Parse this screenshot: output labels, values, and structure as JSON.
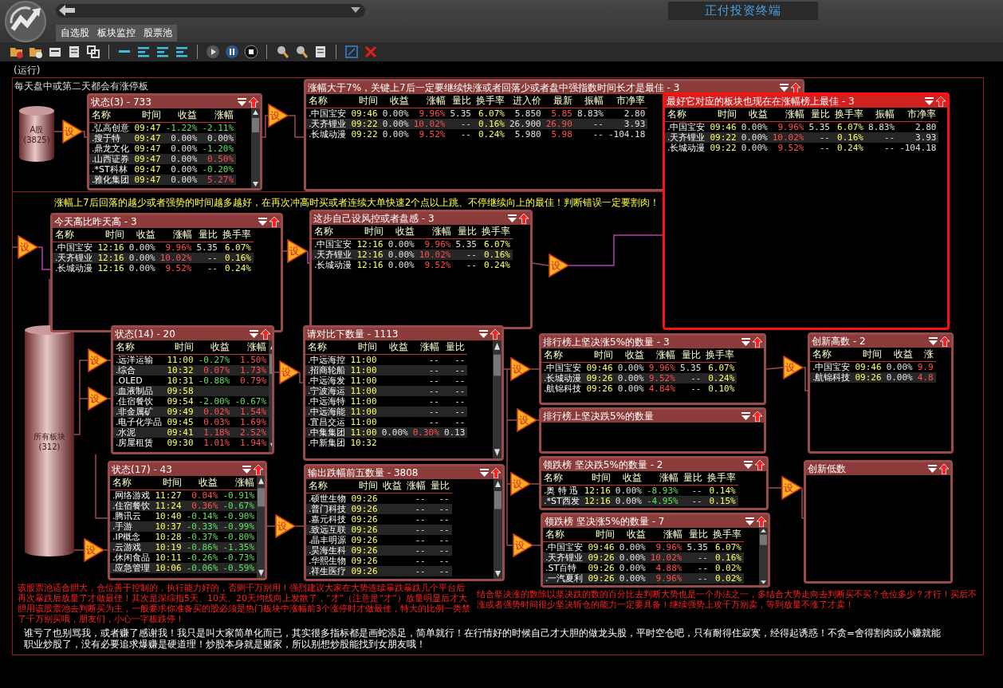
{
  "app": {
    "title": "正付投资终端"
  },
  "tabs": [
    {
      "label": "自选股",
      "selected": false
    },
    {
      "label": "板块监控",
      "selected": false
    },
    {
      "label": "股票池",
      "selected": false
    }
  ],
  "status": "(运行)",
  "section_title": "每天盘中或第二天都会有涨停板",
  "section_note": "涨幅上7后回落的越少或者强势的时间越多越好，在再次冲高时买或者连续大单快速2个点以上跳、不停继续向上的最佳！判断错误一定要割肉！",
  "sources": [
    {
      "label": "A股",
      "count": "(3825)"
    },
    {
      "label": "所有板块",
      "count": "(312)"
    }
  ],
  "setters": [
    {
      "label": "设"
    },
    {
      "label": "设"
    },
    {
      "label": "设"
    },
    {
      "label": "设"
    },
    {
      "label": "设"
    },
    {
      "label": "设"
    },
    {
      "label": "设"
    },
    {
      "label": "设"
    },
    {
      "label": "设"
    },
    {
      "label": "设"
    },
    {
      "label": "设"
    },
    {
      "label": "设"
    },
    {
      "label": "设"
    },
    {
      "label": "设"
    },
    {
      "label": "设"
    },
    {
      "label": "设"
    }
  ],
  "panels": [
    {
      "title": "状态(3) - 733",
      "highlighted": false,
      "scrollbar": true,
      "columns": [
        {
          "label": "名称",
          "kind": "name"
        },
        {
          "label": "时间",
          "kind": "time"
        },
        {
          "label": "收益",
          "kind": "signed"
        },
        {
          "label": "涨幅",
          "kind": "signed"
        }
      ],
      "rows": [
        [
          ".弘高创意",
          "09:47",
          "-1.22%",
          "-2.11%"
        ],
        [
          ".搜于特",
          "09:47",
          "0.00%",
          "0.00%"
        ],
        [
          ".鼎龙文化",
          "09:47",
          "0.00%",
          "-1.20%"
        ],
        [
          ".山西证券",
          "09:47",
          "0.00%",
          "0.50%"
        ],
        [
          ".*ST科林",
          "09:47",
          "0.00%",
          "-0.20%"
        ],
        [
          ".雅化集团",
          "09:47",
          "0.00%",
          "5.27%"
        ]
      ]
    },
    {
      "title": "涨幅大于7%，关键上7后一定要继续快涨或者回落少或者盘中强指数时间长才是最佳 - 3",
      "highlighted": false,
      "scrollbar": false,
      "columns": [
        {
          "label": "名称",
          "kind": "name"
        },
        {
          "label": "时间",
          "kind": "time"
        },
        {
          "label": "收益",
          "kind": "signed"
        },
        {
          "label": "涨幅",
          "kind": "signed"
        },
        {
          "label": "量比",
          "kind": "plain"
        },
        {
          "label": "换手率",
          "kind": "turnover"
        },
        {
          "label": "进入价",
          "kind": "plain"
        },
        {
          "label": "最新",
          "kind": "latest"
        },
        {
          "label": "振幅",
          "kind": "plain"
        },
        {
          "label": "市净率",
          "kind": "plain"
        }
      ],
      "rows": [
        [
          ".中国宝安",
          "09:46",
          "0.00%",
          "9.96%",
          "5.35",
          "6.07%",
          "5.850",
          "5.85",
          "8.83%",
          "2.80"
        ],
        [
          ".天齐锂业",
          "09:22",
          "0.00%",
          "10.02%",
          "--",
          "0.16%",
          "26.900",
          "26.90",
          "--",
          "3.93"
        ],
        [
          ".长城动漫",
          "09:22",
          "0.00%",
          "9.52%",
          "--",
          "0.24%",
          "5.980",
          "5.98",
          "--",
          "-104.18"
        ]
      ]
    },
    {
      "title": "最好它对应的板块也现在在涨幅榜上最佳 - 3",
      "highlighted": true,
      "scrollbar": false,
      "columns": [
        {
          "label": "名称",
          "kind": "name"
        },
        {
          "label": "时间",
          "kind": "time"
        },
        {
          "label": "收益",
          "kind": "signed"
        },
        {
          "label": "涨幅",
          "kind": "signed"
        },
        {
          "label": "量比",
          "kind": "plain"
        },
        {
          "label": "换手率",
          "kind": "turnover"
        },
        {
          "label": "振幅",
          "kind": "plain"
        },
        {
          "label": "市净率",
          "kind": "plain"
        }
      ],
      "rows": [
        [
          ".中国宝安",
          "09:46",
          "0.00%",
          "9.96%",
          "5.35",
          "6.07%",
          "8.83%",
          "2.80"
        ],
        [
          ".天齐锂业",
          "09:22",
          "0.00%",
          "10.02%",
          "--",
          "0.16%",
          "--",
          "3.93"
        ],
        [
          ".长城动漫",
          "09:22",
          "0.00%",
          "9.52%",
          "--",
          "0.24%",
          "--",
          "-104.18"
        ]
      ]
    },
    {
      "title": "今天高比昨天高 - 3",
      "highlighted": false,
      "scrollbar": false,
      "columns": [
        {
          "label": "名称",
          "kind": "name"
        },
        {
          "label": "时间",
          "kind": "time"
        },
        {
          "label": "收益",
          "kind": "signed"
        },
        {
          "label": "涨幅",
          "kind": "signed"
        },
        {
          "label": "量比",
          "kind": "plain"
        },
        {
          "label": "换手率",
          "kind": "turnover"
        }
      ],
      "rows": [
        [
          ".中国宝安",
          "12:16",
          "0.00%",
          "9.96%",
          "5.35",
          "6.07%"
        ],
        [
          ".天齐锂业",
          "12:16",
          "0.00%",
          "10.02%",
          "--",
          "0.16%"
        ],
        [
          ".长城动漫",
          "12:16",
          "0.00%",
          "9.52%",
          "--",
          "0.24%"
        ]
      ]
    },
    {
      "title": "这步自己设风控或者盘感 - 3",
      "highlighted": false,
      "scrollbar": false,
      "columns": [
        {
          "label": "名称",
          "kind": "name"
        },
        {
          "label": "时间",
          "kind": "time"
        },
        {
          "label": "收益",
          "kind": "signed"
        },
        {
          "label": "涨幅",
          "kind": "signed"
        },
        {
          "label": "量比",
          "kind": "plain"
        },
        {
          "label": "换手率",
          "kind": "turnover"
        }
      ],
      "rows": [
        [
          ".中国宝安",
          "12:16",
          "0.00%",
          "9.96%",
          "5.35",
          "6.07%"
        ],
        [
          ".天齐锂业",
          "12:16",
          "0.00%",
          "10.02%",
          "--",
          "0.16%"
        ],
        [
          ".长城动漫",
          "12:16",
          "0.00%",
          "9.52%",
          "--",
          "0.24%"
        ]
      ]
    },
    {
      "title": "状态(14) - 20",
      "highlighted": false,
      "scrollbar": true,
      "columns": [
        {
          "label": "名称",
          "kind": "name"
        },
        {
          "label": "时间",
          "kind": "time"
        },
        {
          "label": "收益",
          "kind": "signed"
        },
        {
          "label": "涨幅",
          "kind": "signed"
        }
      ],
      "rows": [
        [
          ".远洋运输",
          "11:00",
          "-0.27%",
          "1.50%"
        ],
        [
          ".综合",
          "10:32",
          "0.07%",
          "1.73%"
        ],
        [
          ".OLED",
          "10:31",
          "-0.88%",
          "0.79%"
        ],
        [
          ".血液制品",
          "09:58",
          null,
          null
        ],
        [
          ".住宿餐饮",
          "09:54",
          "-2.00%",
          "-0.67%"
        ],
        [
          ".非金属矿",
          "09:49",
          "0.02%",
          "1.54%"
        ],
        [
          ".电子化学品",
          "09:45",
          "0.03%",
          "1.69%"
        ],
        [
          ".水泥",
          "09:41",
          "1.18%",
          "2.52%"
        ],
        [
          ".房屋租赁",
          "09:30",
          "1.01%",
          "1.94%"
        ]
      ]
    },
    {
      "title": "状态(17) - 43",
      "highlighted": false,
      "scrollbar": true,
      "columns": [
        {
          "label": "名称",
          "kind": "name"
        },
        {
          "label": "时间",
          "kind": "time"
        },
        {
          "label": "收益",
          "kind": "signed"
        },
        {
          "label": "涨幅",
          "kind": "signed"
        }
      ],
      "rows": [
        [
          ".网络游戏",
          "11:27",
          "0.04%",
          "-0.91%"
        ],
        [
          ".住宿餐饮",
          "11:24",
          "0.36%",
          "-0.67%"
        ],
        [
          ".腾讯云",
          "10:40",
          "-0.14%",
          "-0.90%"
        ],
        [
          ".手游",
          "10:37",
          "-0.33%",
          "-0.99%"
        ],
        [
          ".IP概念",
          "10:28",
          "-0.37%",
          "-0.80%"
        ],
        [
          ".云游戏",
          "10:19",
          "-0.86%",
          "-1.35%"
        ],
        [
          ".休闲食品",
          "10:11",
          "-0.26%",
          "-0.73%"
        ],
        [
          ".应急管理",
          "10:06",
          "-0.06%",
          "-0.59%"
        ]
      ]
    },
    {
      "title": "请对比下数量 - 1113",
      "highlighted": false,
      "scrollbar": true,
      "columns": [
        {
          "label": "名称",
          "kind": "name"
        },
        {
          "label": "时间",
          "kind": "time"
        },
        {
          "label": "收益",
          "kind": "signed"
        },
        {
          "label": "涨幅",
          "kind": "signed"
        },
        {
          "label": "量比",
          "kind": "plain"
        }
      ],
      "rows": [
        [
          ".中远海控",
          "11:00",
          null,
          "--",
          "--"
        ],
        [
          ".招商轮船",
          "11:00",
          null,
          "--",
          "--"
        ],
        [
          ".中远海发",
          "11:00",
          null,
          "--",
          "--"
        ],
        [
          ".宁波海运",
          "11:00",
          null,
          "--",
          "--"
        ],
        [
          ".中远海特",
          "11:00",
          null,
          "--",
          "--"
        ],
        [
          ".中远海能",
          "11:00",
          null,
          "--",
          "--"
        ],
        [
          ".宜昌交运",
          "11:00",
          null,
          "--",
          "--"
        ],
        [
          ".中集集团",
          "11:00",
          "0.00%",
          "0.30%",
          "0.13"
        ],
        [
          ".中新集团",
          "10:32",
          null,
          null,
          null
        ]
      ]
    },
    {
      "title": "输出跌幅前五数量 - 3808",
      "highlighted": false,
      "scrollbar": true,
      "columns": [
        {
          "label": "名称",
          "kind": "name"
        },
        {
          "label": "时间",
          "kind": "time"
        },
        {
          "label": "收益",
          "kind": "signed"
        },
        {
          "label": "涨幅",
          "kind": "signed"
        },
        {
          "label": "量比",
          "kind": "plain"
        }
      ],
      "rows": [
        [
          ".硕世生物",
          "09:26",
          null,
          "--",
          "--"
        ],
        [
          ".普门科技",
          "09:26",
          null,
          "--",
          "--"
        ],
        [
          ".嘉元科技",
          "09:26",
          null,
          "--",
          "--"
        ],
        [
          ".致远互联",
          "09:26",
          null,
          "--",
          "--"
        ],
        [
          ".晶丰明源",
          "09:26",
          null,
          "--",
          "--"
        ],
        [
          ".昊海生科",
          "09:26",
          null,
          "--",
          "--"
        ],
        [
          ".华熙生物",
          "09:26",
          null,
          "--",
          "--"
        ],
        [
          ".祥生医疗",
          "09:26",
          null,
          "--",
          "--"
        ]
      ]
    },
    {
      "title": "排行榜上坚决涨5%的数量 - 3",
      "highlighted": false,
      "scrollbar": false,
      "columns": [
        {
          "label": "名称",
          "kind": "name"
        },
        {
          "label": "时间",
          "kind": "time"
        },
        {
          "label": "收益",
          "kind": "signed"
        },
        {
          "label": "涨幅",
          "kind": "signed"
        },
        {
          "label": "量比",
          "kind": "plain"
        },
        {
          "label": "换手率",
          "kind": "turnover"
        }
      ],
      "rows": [
        [
          ".中国宝安",
          "09:46",
          "0.00%",
          "9.96%",
          "5.35",
          "6.07%"
        ],
        [
          ".长城动漫",
          "09:26",
          "0.00%",
          "9.52%",
          "--",
          "0.24%"
        ],
        [
          ".航锦科技",
          "09:26",
          "0.00%",
          "4.84%",
          "--",
          "0.10%"
        ]
      ]
    },
    {
      "title": "排行榜上坚决跌5%的数量",
      "highlighted": false,
      "scrollbar": false
    },
    {
      "title": "领跌榜 坚决跌5%的数量 - 2",
      "highlighted": false,
      "scrollbar": false,
      "columns": [
        {
          "label": "名称",
          "kind": "name"
        },
        {
          "label": "时间",
          "kind": "time"
        },
        {
          "label": "收益",
          "kind": "signed"
        },
        {
          "label": "涨幅",
          "kind": "signed"
        },
        {
          "label": "量比",
          "kind": "plain"
        },
        {
          "label": "换手率",
          "kind": "turnover"
        }
      ],
      "rows": [
        [
          ".奥 特 迅",
          "12:16",
          "0.00%",
          "-8.93%",
          "--",
          "0.14%"
        ],
        [
          ".*ST西发",
          "12:16",
          "0.00%",
          "-4.95%",
          "--",
          "0.15%"
        ]
      ]
    },
    {
      "title": "领跌榜 坚决涨5%的数量 - 7",
      "highlighted": false,
      "scrollbar": true,
      "columns": [
        {
          "label": "名称",
          "kind": "name"
        },
        {
          "label": "时间",
          "kind": "time"
        },
        {
          "label": "收益",
          "kind": "signed"
        },
        {
          "label": "涨幅",
          "kind": "signed"
        },
        {
          "label": "量比",
          "kind": "plain"
        },
        {
          "label": "换手率",
          "kind": "turnover"
        }
      ],
      "rows": [
        [
          ".中国宝安",
          "09:46",
          "0.00%",
          "9.96%",
          "5.35",
          "6.07%"
        ],
        [
          ".天齐锂业",
          "09:26",
          "0.00%",
          "10.02%",
          "--",
          "0.16%"
        ],
        [
          ".ST百特",
          "09:26",
          "0.00%",
          "4.88%",
          "--",
          "0.02%"
        ],
        [
          ".一汽夏利",
          "09:26",
          "0.00%",
          "9.96%",
          "--",
          "0.02%"
        ]
      ]
    },
    {
      "title": "创新高数 - 2",
      "highlighted": false,
      "scrollbar": false,
      "columns": [
        {
          "label": "名称",
          "kind": "name"
        },
        {
          "label": "时间",
          "kind": "time"
        },
        {
          "label": "收益",
          "kind": "signed"
        },
        {
          "label": "涨",
          "kind": "signed"
        }
      ],
      "rows": [
        [
          ".中国宝安",
          "09:46",
          "0.00%",
          "9.9"
        ],
        [
          ".航锦科技",
          "09:26",
          "0.00%",
          "4.8"
        ]
      ]
    },
    {
      "title": "创新低数",
      "highlighted": false,
      "scrollbar": false
    }
  ],
  "footer": {
    "warning_left": "该股票池适合胆大，仓位善于控制的，执行能力好的，否则千万别用！强烈建议大家在大势连续暴跌暴跌几个平台后再次暴跌后放量了才做最佳！其次是深综指5天、10天、20天均线向上发散了，“才”（注意是“才”）放量明显后才大胆用该股票池去判断买为主，一般要求你准备买的股必须是热门板块中涨幅前3个涨停时才做最佳，特大的比例一类禁了千万别买哦，朋友们，小心一字板跌停！",
    "warning_right": "结合坚决涨的数除以坚决跌的数的百分比去判断大势也是一个办法之一，多结合大势走向去判断买不买？仓位多少？才行！买后不涨或者强势时间很少坚决斩仓的能力一定要具备！继续强势上攻千万别卖，等到放量不涨了才卖！",
    "remark": "谁亏了也别骂我，或者赚了感谢我！我只是叫大家简单化而已，其实很多指标都是画蛇添足，简单就行！在行情好的时候自己才大胆的做龙头股，平时空仓吧，只有耐得住寂寞，经得起诱惑！不贪=舍得割肉或小赚就能职业炒股了，没有必要追求爆赚是硬道理！炒股本身就是赌家，所以别想炒股能找到女朋友哦！"
  }
}
